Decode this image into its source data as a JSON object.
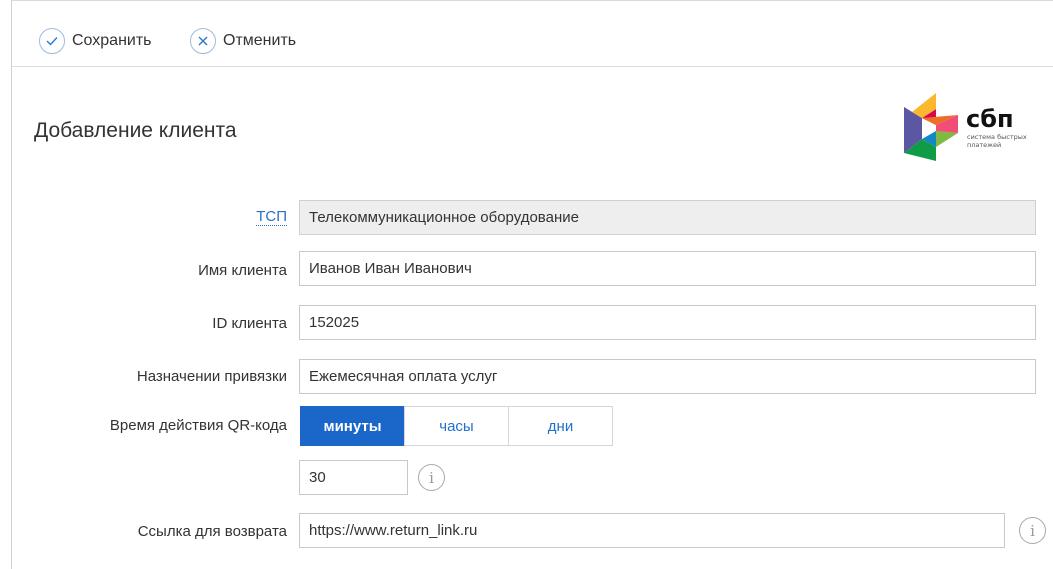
{
  "toolbar": {
    "save_label": "Сохранить",
    "cancel_label": "Отменить"
  },
  "page": {
    "title": "Добавление клиента"
  },
  "logo": {
    "brand": "сбп",
    "tagline_line1": "система быстрых",
    "tagline_line2": "платежей"
  },
  "form": {
    "tsp": {
      "label": "ТСП",
      "value": "Телекоммуникационное оборудование"
    },
    "client_name": {
      "label": "Имя клиента",
      "value": "Иванов Иван Иванович"
    },
    "client_id": {
      "label": "ID клиента",
      "value": "152025"
    },
    "purpose": {
      "label": "Назначении привязки",
      "value": "Ежемесячная оплата услуг"
    },
    "qr_validity": {
      "label": "Время действия QR-кода",
      "options": [
        "минуты",
        "часы",
        "дни"
      ],
      "selected": "минуты",
      "value": "30"
    },
    "return_link": {
      "label": "Ссылка для возврата",
      "value": "https://www.return_link.ru"
    }
  },
  "icons": {
    "save": "check-icon",
    "cancel": "close-icon",
    "info": "info-icon"
  },
  "colors": {
    "accent": "#1a66c9",
    "link": "#2a70c6",
    "readonly_bg": "#eeeeee"
  }
}
